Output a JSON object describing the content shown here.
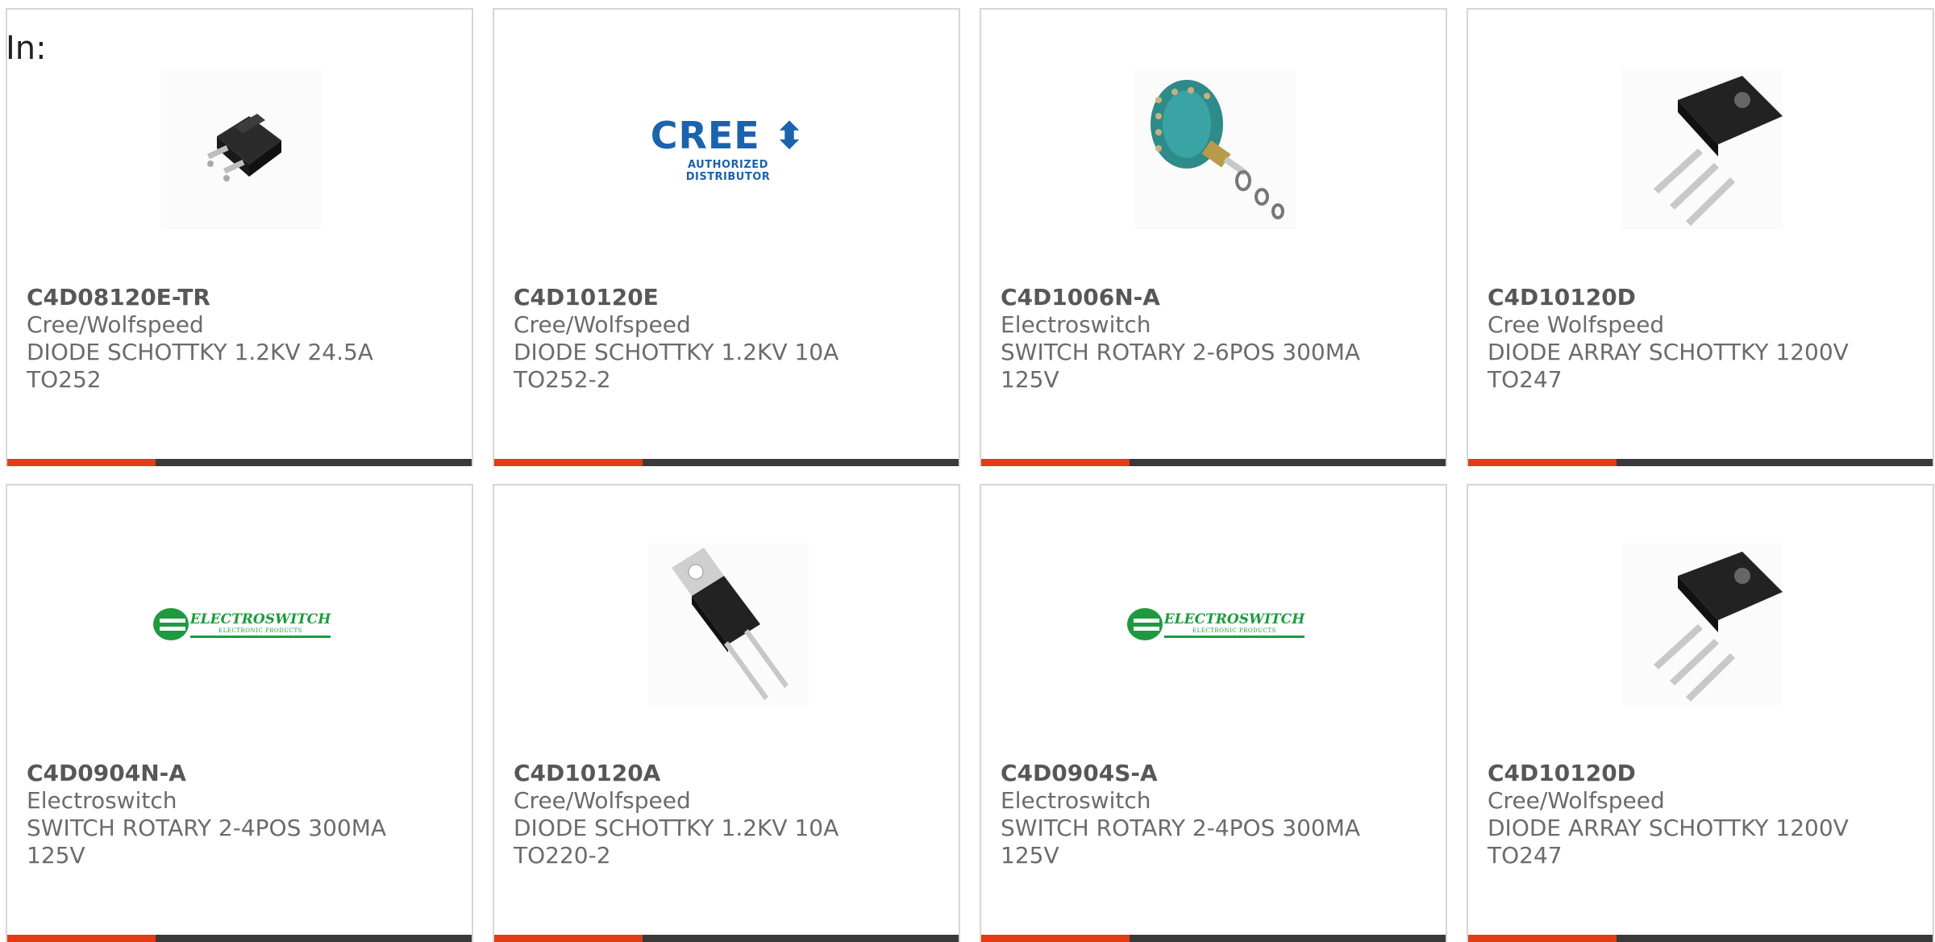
{
  "heading": {
    "label": "In:"
  },
  "colors": {
    "accent": "#e23b16",
    "bar": "#3a3a3a",
    "border": "#d6d6d6",
    "text": "#6b6b6b"
  },
  "products": [
    {
      "part_number": "C4D08120E-TR",
      "manufacturer": "Cree/Wolfspeed",
      "desc1": "DIODE SCHOTTKY 1.2KV 24.5A",
      "desc2": "TO252",
      "image": "to252-package"
    },
    {
      "part_number": "C4D10120E",
      "manufacturer": "Cree/Wolfspeed",
      "desc1": "DIODE SCHOTTKY 1.2KV 10A",
      "desc2": "TO252-2",
      "image": "cree-logo",
      "logo": {
        "word": "CREE",
        "tagline": "AUTHORIZED DISTRIBUTOR"
      }
    },
    {
      "part_number": "C4D1006N-A",
      "manufacturer": "Electroswitch",
      "desc1": "SWITCH ROTARY 2-6POS 300MA",
      "desc2": "125V",
      "image": "rotary-switch"
    },
    {
      "part_number": "C4D10120D",
      "manufacturer": "Cree Wolfspeed",
      "desc1": "DIODE ARRAY SCHOTTKY 1200V",
      "desc2": "TO247",
      "image": "to247-package"
    },
    {
      "part_number": "C4D0904N-A",
      "manufacturer": "Electroswitch",
      "desc1": "SWITCH ROTARY 2-4POS 300MA",
      "desc2": "125V",
      "image": "electroswitch-logo",
      "logo": {
        "word": "ELECTROSWITCH",
        "tagline": "ELECTRONIC PRODUCTS"
      }
    },
    {
      "part_number": "C4D10120A",
      "manufacturer": "Cree/Wolfspeed",
      "desc1": "DIODE SCHOTTKY 1.2KV 10A",
      "desc2": "TO220-2",
      "image": "to220-package"
    },
    {
      "part_number": "C4D0904S-A",
      "manufacturer": "Electroswitch",
      "desc1": "SWITCH ROTARY 2-4POS 300MA",
      "desc2": "125V",
      "image": "electroswitch-logo",
      "logo": {
        "word": "ELECTROSWITCH",
        "tagline": "ELECTRONIC PRODUCTS"
      }
    },
    {
      "part_number": "C4D10120D",
      "manufacturer": "Cree/Wolfspeed",
      "desc1": "DIODE ARRAY SCHOTTKY 1200V",
      "desc2": "TO247",
      "image": "to247-package"
    }
  ]
}
